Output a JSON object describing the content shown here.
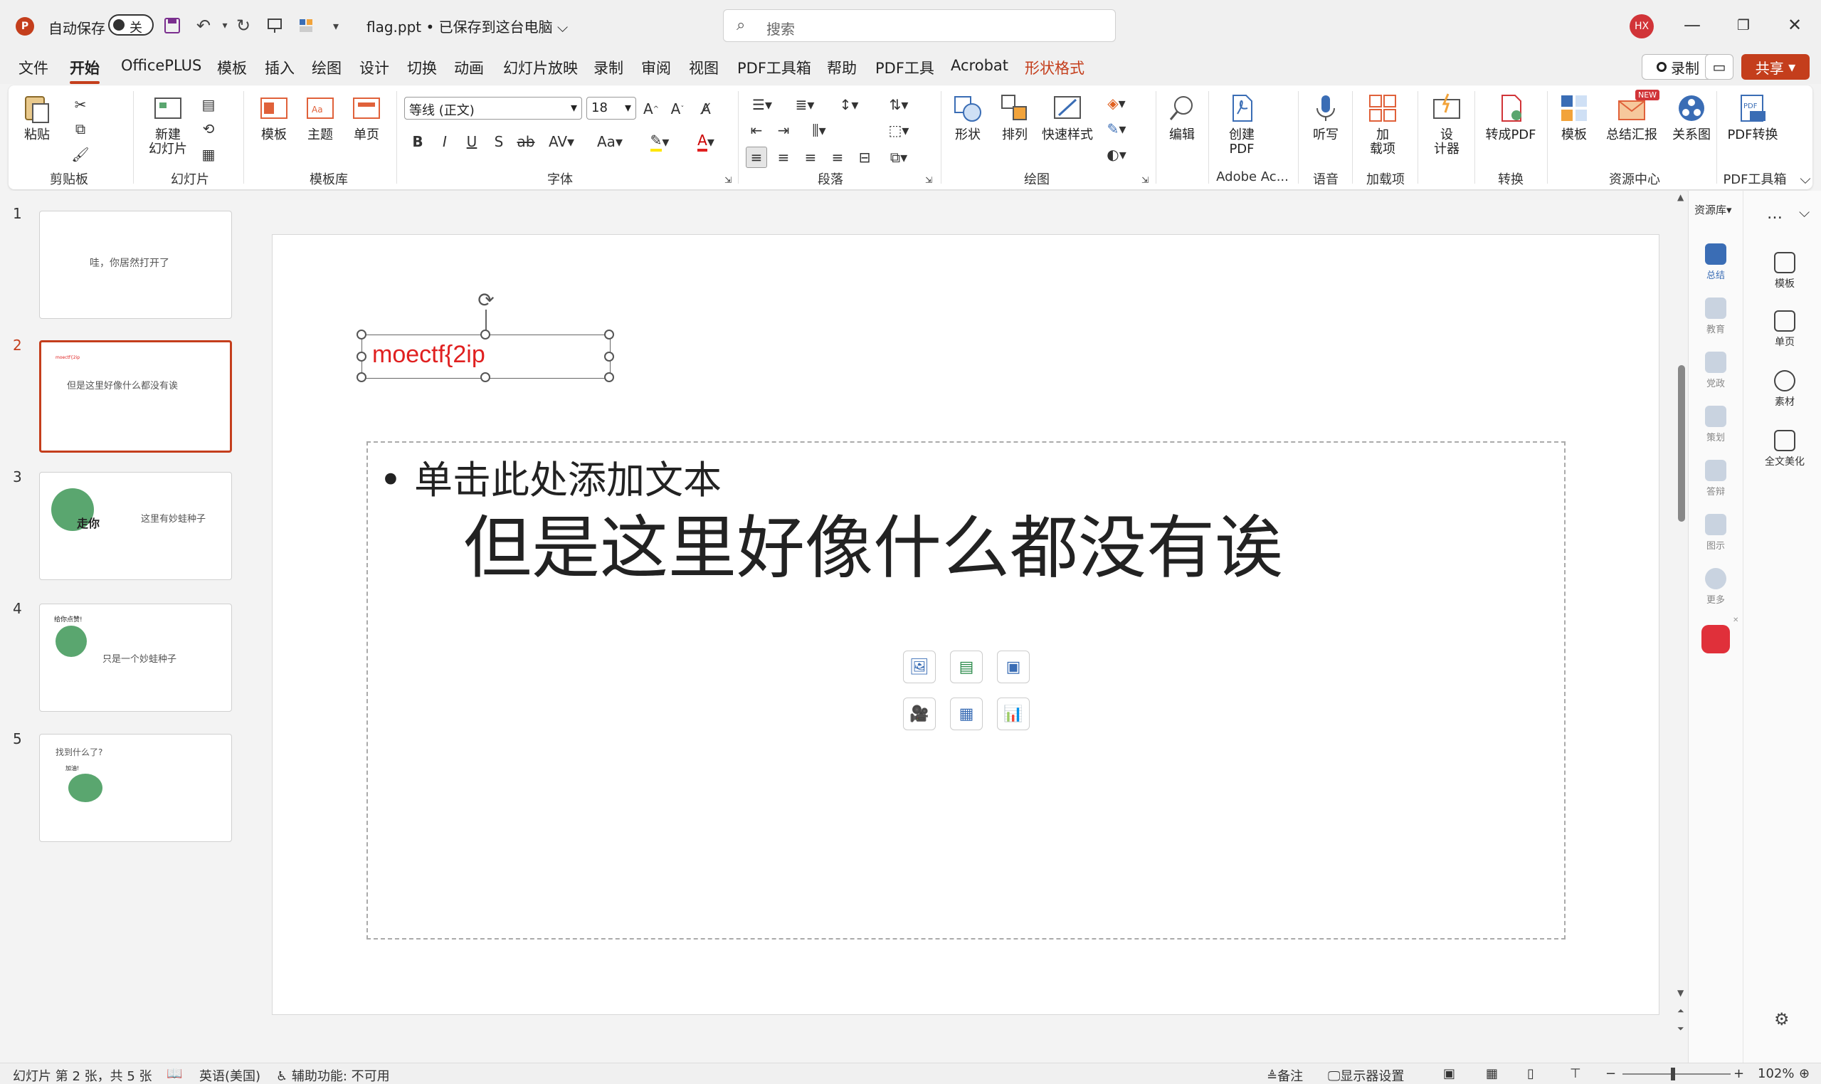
{
  "titlebar": {
    "autosave_label": "自动保存",
    "autosave_state": "关",
    "file_title": "flag.ppt • 已保存到这台电脑",
    "search_placeholder": "搜索",
    "user_initials": "HX"
  },
  "menu": {
    "tabs": [
      "文件",
      "开始",
      "OfficePLUS",
      "模板",
      "插入",
      "绘图",
      "设计",
      "切换",
      "动画",
      "幻灯片放映",
      "录制",
      "审阅",
      "视图",
      "PDF工具箱",
      "帮助",
      "PDF工具",
      "Acrobat",
      "形状格式"
    ],
    "active_tab": "开始",
    "record_label": "录制",
    "share_label": "共享"
  },
  "ribbon": {
    "paste": "粘贴",
    "new_slide": "新建\n幻灯片",
    "template": "模板",
    "theme": "主题",
    "single_page": "单页",
    "font_name": "等线 (正文)",
    "font_size": "18",
    "shape": "形状",
    "arrange": "排列",
    "quick_style": "快速样式",
    "edit": "编辑",
    "create_pdf": "创建\nPDF",
    "dictate": "听写",
    "addins": "加\n载项",
    "designer": "设\n计器",
    "to_pdf": "转成PDF",
    "res_template": "模板",
    "summary": "总结汇报",
    "relation": "关系图",
    "pdf_convert": "PDF转换",
    "new_badge": "NEW",
    "groups": {
      "clipboard": "剪贴板",
      "slides": "幻灯片",
      "template_lib": "模板库",
      "font": "字体",
      "paragraph": "段落",
      "drawing": "绘图",
      "adobe": "Adobe Ac...",
      "voice": "语音",
      "addins": "加载项",
      "convert": "转换",
      "resource": "资源中心",
      "pdf_tools": "PDF工具箱"
    }
  },
  "thumbnails": [
    {
      "num": "1",
      "text": "哇，你居然打开了"
    },
    {
      "num": "2",
      "text": "但是这里好像什么都没有诶",
      "small": "moectf{2ip"
    },
    {
      "num": "3",
      "text": "这里有妙蛙种子",
      "sticker": "走你"
    },
    {
      "num": "4",
      "text": "只是一个妙蛙种子",
      "sticker": "给你点赞!"
    },
    {
      "num": "5",
      "text": "找到什么了?",
      "sticker": "加油!"
    }
  ],
  "slide": {
    "title": "moectf{2ip",
    "bullet": "单击此处添加文本",
    "body": "但是这里好像什么都没有诶"
  },
  "rightpanel": {
    "header": "资源库",
    "items": [
      "总结",
      "教育",
      "党政",
      "策划",
      "答辩",
      "图示",
      "更多"
    ],
    "side_items": [
      "模板",
      "单页",
      "素材",
      "全文美化"
    ]
  },
  "status": {
    "slide_info": "幻灯片 第 2 张，共 5 张",
    "language": "英语(美国)",
    "accessibility": "辅助功能: 不可用",
    "notes": "备注",
    "display_settings": "显示器设置",
    "zoom": "102%"
  }
}
